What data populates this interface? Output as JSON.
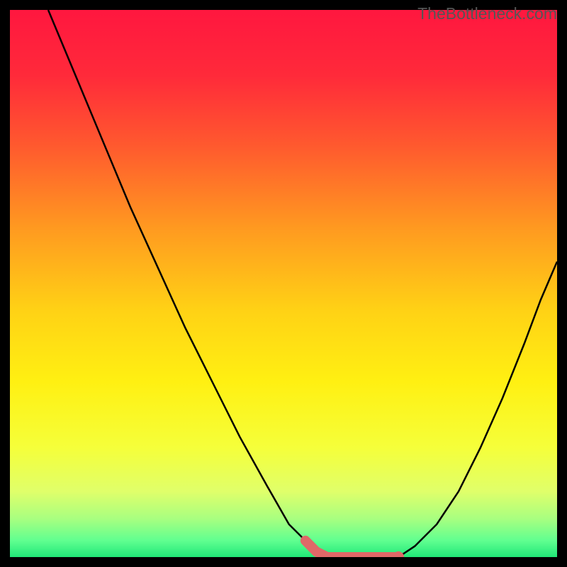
{
  "watermark": "TheBottleneck.com",
  "chart_data": {
    "type": "line",
    "title": "",
    "xlabel": "",
    "ylabel": "",
    "xlim": [
      0,
      100
    ],
    "ylim": [
      0,
      100
    ],
    "series": [
      {
        "name": "left-curve",
        "x": [
          7,
          12,
          17,
          22,
          27,
          32,
          37,
          42,
          47,
          51,
          54,
          56,
          58
        ],
        "y": [
          100,
          88,
          76,
          64,
          53,
          42,
          32,
          22,
          13,
          6,
          3,
          1,
          0
        ]
      },
      {
        "name": "right-curve",
        "x": [
          71,
          74,
          78,
          82,
          86,
          90,
          94,
          97,
          100
        ],
        "y": [
          0,
          2,
          6,
          12,
          20,
          29,
          39,
          47,
          54
        ]
      },
      {
        "name": "valley-highlight",
        "x": [
          54,
          56,
          58,
          60,
          62,
          64,
          66,
          68,
          70,
          71
        ],
        "y": [
          3,
          1,
          0,
          0,
          0,
          0,
          0,
          0,
          0,
          0
        ]
      }
    ],
    "gradient_stops": [
      {
        "offset": 0.0,
        "color": "#ff173f"
      },
      {
        "offset": 0.12,
        "color": "#ff2a3a"
      },
      {
        "offset": 0.25,
        "color": "#ff5a2e"
      },
      {
        "offset": 0.4,
        "color": "#ff9a20"
      },
      {
        "offset": 0.55,
        "color": "#ffd215"
      },
      {
        "offset": 0.68,
        "color": "#fff012"
      },
      {
        "offset": 0.8,
        "color": "#f5ff3a"
      },
      {
        "offset": 0.88,
        "color": "#e0ff6a"
      },
      {
        "offset": 0.93,
        "color": "#a8ff80"
      },
      {
        "offset": 0.97,
        "color": "#60ff90"
      },
      {
        "offset": 1.0,
        "color": "#20e878"
      }
    ],
    "highlight_color": "#e06868"
  }
}
